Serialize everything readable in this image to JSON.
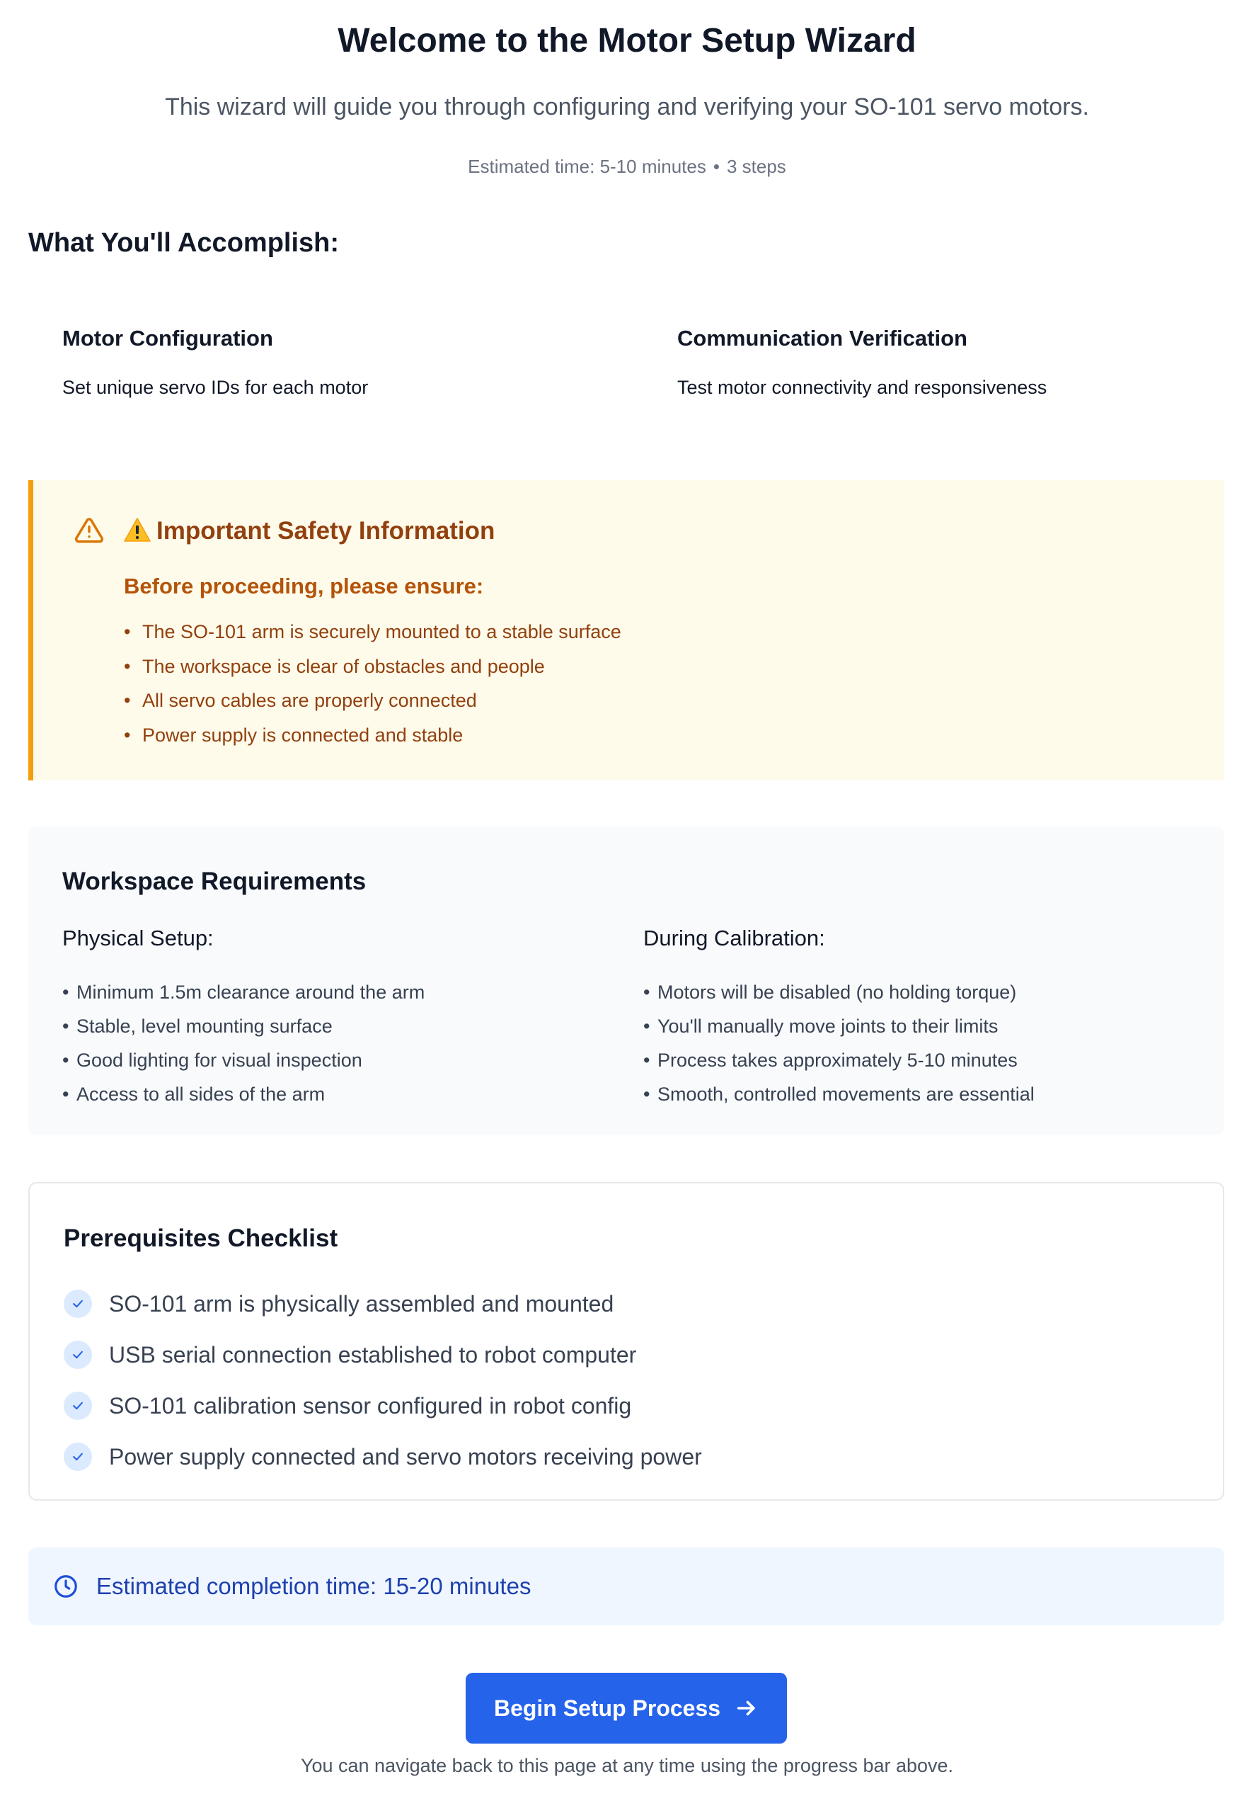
{
  "header": {
    "title": "Welcome to the Motor Setup Wizard",
    "subtitle": "This wizard will guide you through configuring and verifying your SO-101 servo motors.",
    "estimated_time": "Estimated time: 5-10 minutes",
    "separator": "•",
    "steps": "3 steps"
  },
  "accomplish": {
    "heading": "What You'll Accomplish:",
    "items": [
      {
        "title": "Motor Configuration",
        "description": "Set unique servo IDs for each motor"
      },
      {
        "title": "Communication Verification",
        "description": "Test motor connectivity and responsiveness"
      }
    ]
  },
  "safety": {
    "title": "Important Safety Information",
    "subtitle": "Before proceeding, please ensure:",
    "items": [
      "The SO-101 arm is securely mounted to a stable surface",
      "The workspace is clear of obstacles and people",
      "All servo cables are properly connected",
      "Power supply is connected and stable"
    ],
    "colors": {
      "background": "#fffbeb",
      "border": "#f59e0b",
      "text": "#92400e"
    }
  },
  "workspace": {
    "title": "Workspace Requirements",
    "physical": {
      "title": "Physical Setup:",
      "items": [
        "Minimum 1.5m clearance around the arm",
        "Stable, level mounting surface",
        "Good lighting for visual inspection",
        "Access to all sides of the arm"
      ]
    },
    "calibration": {
      "title": "During Calibration:",
      "items": [
        "Motors will be disabled (no holding torque)",
        "You'll manually move joints to their limits",
        "Process takes approximately 5-10 minutes",
        "Smooth, controlled movements are essential"
      ]
    }
  },
  "prerequisites": {
    "title": "Prerequisites Checklist",
    "items": [
      "SO-101 arm is physically assembled and mounted",
      "USB serial connection established to robot computer",
      "SO-101 calibration sensor configured in robot config",
      "Power supply connected and servo motors receiving power"
    ]
  },
  "estimate": {
    "text": "Estimated completion time: 15-20 minutes"
  },
  "actions": {
    "begin_label": "Begin Setup Process",
    "footnote": "You can navigate back to this page at any time using the progress bar above."
  },
  "icons": {
    "warning": "warning-triangle-icon",
    "check": "check-icon",
    "clock": "clock-icon",
    "arrow": "arrow-right-icon"
  },
  "colors": {
    "primary": "#2563eb",
    "info_background": "#eff6ff",
    "info_text": "#1e40af",
    "panel_background": "#f8fafc"
  }
}
